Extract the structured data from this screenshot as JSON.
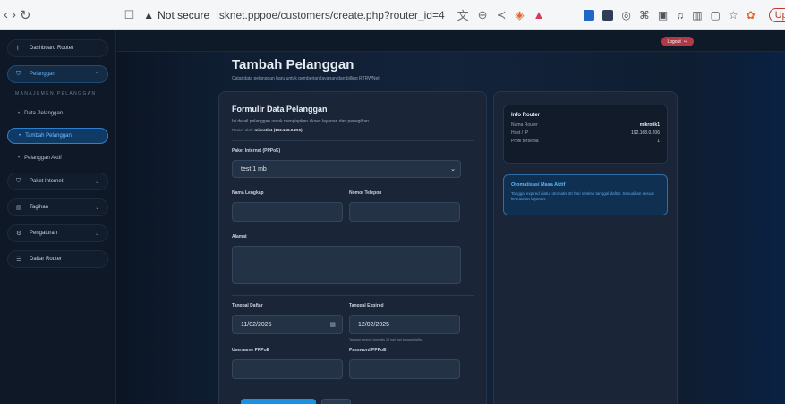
{
  "browser": {
    "back": "‹",
    "forward": "›",
    "reload": "↻",
    "security_label": "Not secure",
    "url": "isknet.pppoe/customers/create.php?router_id=4",
    "update_label": "Update"
  },
  "sidebar": {
    "items": [
      {
        "label": "Dashboard Router",
        "icon": "chart-icon"
      },
      {
        "label": "Pelanggan",
        "icon": "user-icon"
      }
    ],
    "section_label": "MANAJEMEN PELANGGAN",
    "sub_items": [
      {
        "label": "Data Pelanggan"
      },
      {
        "label": "Tambah Pelanggan"
      },
      {
        "label": "Pelanggan Aktif"
      }
    ],
    "more_items": [
      {
        "label": "Paket Internet",
        "icon": "package-icon"
      },
      {
        "label": "Tagihan",
        "icon": "invoice-icon"
      },
      {
        "label": "Pengaturan",
        "icon": "gear-icon"
      },
      {
        "label": "Daftar Router",
        "icon": "list-icon"
      }
    ]
  },
  "topbar": {
    "logout_label": "Logout"
  },
  "page": {
    "title": "Tambah Pelanggan",
    "subtitle": "Catat data pelanggan baru untuk pemberian layanan dan billing RTRWNet."
  },
  "form": {
    "title": "Formulir Data Pelanggan",
    "description": "Isi detail pelanggan untuk menyiapkan akses layanan dan penagihan.",
    "router_prefix": "Router aktif:",
    "router_value": "mikrotik1 (192.168.0.206)",
    "package_label": "Paket Internet (PPPoE)",
    "package_value": "test 1 mb",
    "name_label": "Nama Lengkap",
    "phone_label": "Nomor Telepon",
    "address_label": "Alamat",
    "reg_date_label": "Tanggal Daftar",
    "reg_date_value": "11/02/2025",
    "exp_date_label": "Tanggal Expired",
    "exp_date_value": "12/02/2025",
    "exp_hint": "Tanggal expired otomatis 30 hari dari tanggal daftar.",
    "username_label": "Username PPPoE",
    "password_label": "Password PPPoE"
  },
  "info": {
    "title": "Info Router",
    "rows": [
      {
        "key": "Nama Router",
        "value": "mikrotik1"
      },
      {
        "key": "Host / IP",
        "value": "192.168.0.206"
      },
      {
        "key": "Profil tersedia",
        "value": "1"
      }
    ],
    "auto_title": "Otomatisasi Masa Aktif",
    "auto_text": "Tanggal expired diatur otomatis 30 hari setelah tanggal daftar. Sesuaikan sesuai kebutuhan layanan."
  }
}
